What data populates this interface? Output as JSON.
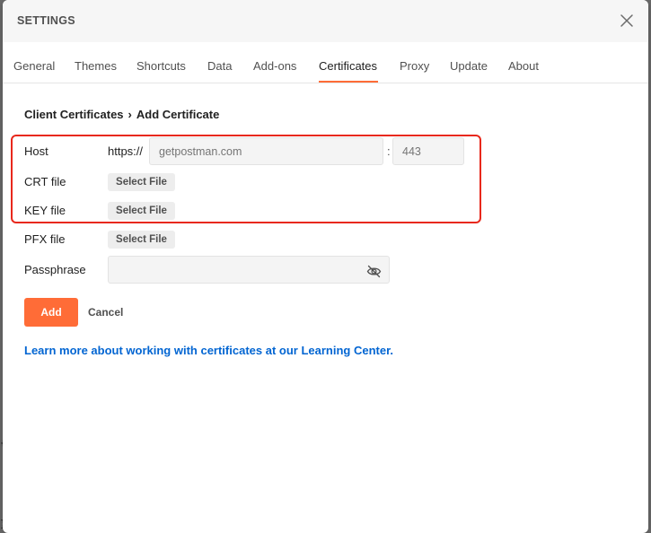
{
  "backdrop": {
    "frag1": "{",
    "frag2": "{",
    "frag3": "}"
  },
  "modal": {
    "title": "SETTINGS",
    "close_icon": "close-icon"
  },
  "tabs": [
    {
      "label": "General"
    },
    {
      "label": "Themes"
    },
    {
      "label": "Shortcuts"
    },
    {
      "label": "Data"
    },
    {
      "label": "Add-ons"
    },
    {
      "label": "Certificates",
      "active": true
    },
    {
      "label": "Proxy"
    },
    {
      "label": "Update"
    },
    {
      "label": "About"
    }
  ],
  "breadcrumb": {
    "parent": "Client Certificates",
    "separator": "›",
    "current": "Add Certificate"
  },
  "form": {
    "host": {
      "label": "Host",
      "prefix": "https://",
      "host_placeholder": "getpostman.com",
      "host_value": "",
      "colon": ":",
      "port_placeholder": "443",
      "port_value": ""
    },
    "crt": {
      "label": "CRT file",
      "button": "Select File"
    },
    "key": {
      "label": "KEY file",
      "button": "Select File"
    },
    "pfx": {
      "label": "PFX file",
      "button": "Select File"
    },
    "passphrase": {
      "label": "Passphrase",
      "value": "",
      "toggle_icon": "eye-off-icon"
    }
  },
  "actions": {
    "add": "Add",
    "cancel": "Cancel"
  },
  "learn_more": "Learn more about working with certificates at our Learning Center.",
  "colors": {
    "accent": "#ff6c37",
    "link": "#0265d2",
    "highlight": "#e8281c"
  }
}
